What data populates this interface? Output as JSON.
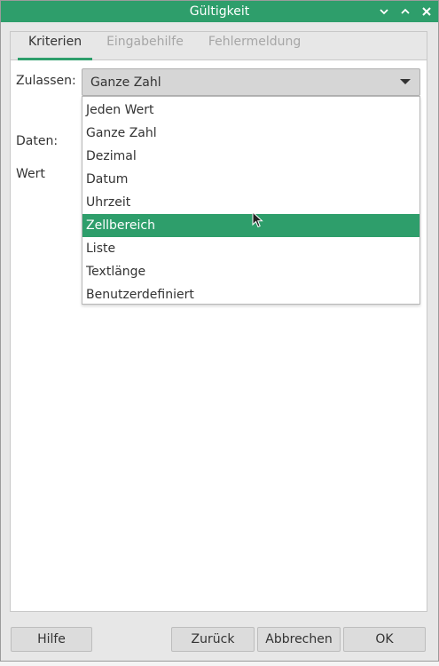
{
  "window": {
    "title": "Gültigkeit",
    "titlebar_color": "#2e9e6b"
  },
  "tabs": [
    {
      "label": "Kriterien",
      "active": true
    },
    {
      "label": "Eingabehilfe",
      "active": false
    },
    {
      "label": "Fehlermeldung",
      "active": false
    }
  ],
  "form": {
    "allow_label": "Zulassen:",
    "allow_value": "Ganze Zahl",
    "data_label": "Daten:",
    "value_label": "Wert"
  },
  "dropdown": {
    "options": [
      "Jeden Wert",
      "Ganze Zahl",
      "Dezimal",
      "Datum",
      "Uhrzeit",
      "Zellbereich",
      "Liste",
      "Textlänge",
      "Benutzerdefiniert"
    ],
    "highlighted": "Zellbereich"
  },
  "buttons": {
    "help": "Hilfe",
    "back": "Zurück",
    "cancel": "Abbrechen",
    "ok": "OK"
  },
  "icons": {
    "minimize": "chevron-down-icon",
    "maximize": "chevron-up-icon",
    "close": "close-icon"
  }
}
